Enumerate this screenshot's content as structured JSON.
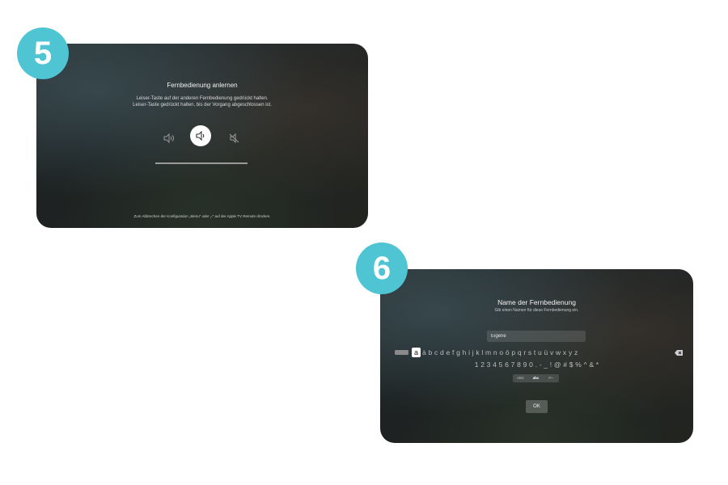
{
  "steps": [
    {
      "number": "5"
    },
    {
      "number": "6"
    }
  ],
  "screen5": {
    "title": "Fernbedienung anlernen",
    "instruction_line1": "Leiser-Taste auf der anderen Fernbedienung gedrückt halten.",
    "instruction_line2": "Leiser-Taste gedrückt halten, bis der Vorgang abgeschlossen ist.",
    "icons": [
      "volume-up-icon",
      "volume-down-icon",
      "mute-icon"
    ],
    "progress": 0,
    "footer": "Zum Abbrechen der Konfiguration „Menu“ oder „‹“ auf der Apple TV Remote drücken."
  },
  "screen6": {
    "title": "Name der Fernbedienung",
    "subtitle": "Gib einen Namen für diese Fernbedienung ein.",
    "input_value": "Eigene",
    "keyboard": {
      "selected_key": "a",
      "letters": "à b c d e f g h i j k l m n o ö p q r s t u ü v w x y z",
      "digits": "1 2 3 4 5 6 7 8 9 0 . - _ ! @ # $ % ^ & *",
      "modes": [
        "ABC",
        "abc",
        "#+-"
      ],
      "active_mode": "abc"
    },
    "ok_label": "OK"
  },
  "colors": {
    "badge": "#4fc4d3",
    "page_background": "#ffffff"
  }
}
